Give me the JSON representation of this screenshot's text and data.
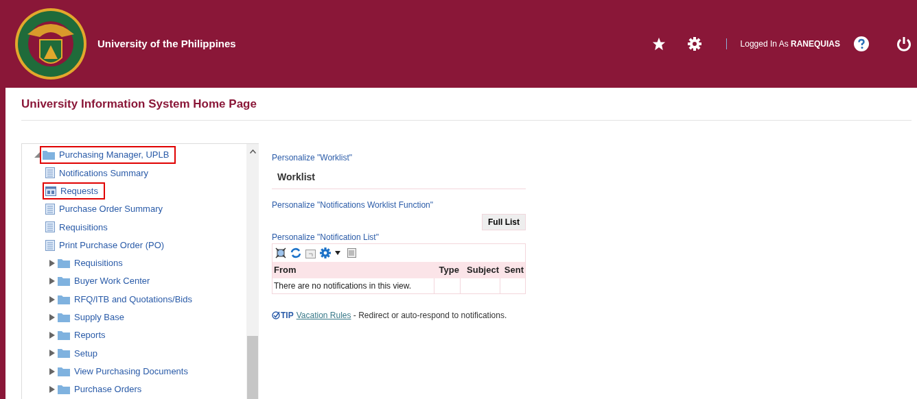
{
  "header": {
    "title": "University of the Philippines",
    "logged_in_label": "Logged In As",
    "user": "RANEQUIAS"
  },
  "page_title": "University Information System Home Page",
  "navigator": {
    "root": {
      "label": "Purchasing Manager, UPLB",
      "kind": "folder",
      "expanded": true,
      "highlighted": true,
      "children": [
        {
          "label": "Notifications Summary",
          "kind": "page",
          "highlighted": false
        },
        {
          "label": "Requests",
          "kind": "form",
          "highlighted": true
        },
        {
          "label": "Purchase Order Summary",
          "kind": "page",
          "highlighted": false
        },
        {
          "label": "Requisitions",
          "kind": "page",
          "highlighted": false
        },
        {
          "label": "Print Purchase Order (PO)",
          "kind": "page",
          "highlighted": false
        },
        {
          "label": "Requisitions",
          "kind": "folder",
          "expanded": false,
          "highlighted": false
        },
        {
          "label": "Buyer Work Center",
          "kind": "folder",
          "expanded": false,
          "highlighted": false
        },
        {
          "label": "RFQ/ITB and Quotations/Bids",
          "kind": "folder",
          "expanded": false,
          "highlighted": false
        },
        {
          "label": "Supply Base",
          "kind": "folder",
          "expanded": false,
          "highlighted": false
        },
        {
          "label": "Reports",
          "kind": "folder",
          "expanded": false,
          "highlighted": false
        },
        {
          "label": "Setup",
          "kind": "folder",
          "expanded": false,
          "highlighted": false
        },
        {
          "label": "View Purchasing Documents",
          "kind": "folder",
          "expanded": false,
          "highlighted": false
        },
        {
          "label": "Purchase Orders",
          "kind": "folder",
          "expanded": false,
          "highlighted": false
        }
      ]
    }
  },
  "worklist": {
    "personalize_worklist": "Personalize \"Worklist\"",
    "title": "Worklist",
    "personalize_function": "Personalize \"Notifications Worklist Function\"",
    "full_list_button": "Full List",
    "personalize_list": "Personalize \"Notification List\"",
    "table": {
      "columns": [
        "From",
        "Type",
        "Subject",
        "Sent"
      ],
      "empty_message": "There are no notifications in this view."
    },
    "tip": {
      "label": "TIP",
      "link": "Vacation Rules",
      "text": " - Redirect or auto-respond to notifications."
    }
  }
}
